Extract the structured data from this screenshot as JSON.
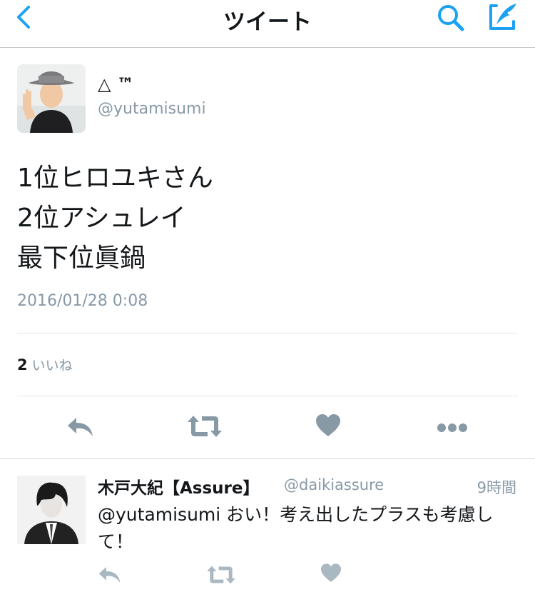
{
  "nav": {
    "title": "ツイート",
    "back_icon": "chevron-left-icon",
    "search_icon": "search-icon",
    "compose_icon": "compose-tweet-icon",
    "accent_color": "#1da1f2"
  },
  "tweet": {
    "display_name": "△ ™",
    "username": "@yutamisumi",
    "text_lines": [
      "1位ヒロユキさん",
      "2位アシュレイ",
      "最下位眞鍋"
    ],
    "timestamp": "2016/01/28 0:08",
    "likes_count": "2",
    "likes_label": "いいね",
    "actions": [
      "reply-icon",
      "retweet-icon",
      "like-heart-icon",
      "more-dots-icon"
    ],
    "action_color": "#8899a6"
  },
  "reply": {
    "display_name": "木戸大紀【Assure】",
    "username": "@daikiassure",
    "time": "9時間",
    "text": "@yutamisumi おい！考え出したプラスも考慮して！",
    "actions": [
      "reply-icon",
      "retweet-icon",
      "like-heart-icon"
    ],
    "action_color": "#aab8c2"
  }
}
